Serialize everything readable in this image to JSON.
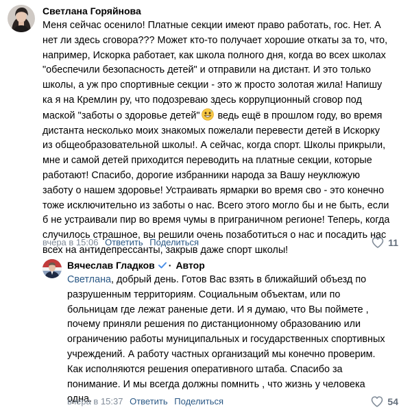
{
  "comment1": {
    "author": "Светлана Горяйнова",
    "lines": [
      "Меня сейчас осенило! Платные секции имеют право работать, гос. Нет. А",
      "нет ли здесь сговора??? Может кто-то получает хорошие откаты за то, что,",
      "например, Искорка работает, как школа полного дня, когда во всех школах",
      "\"обеспечили безопасность детей\" и отправили на дистант. И это только",
      "школы, а уж про спортивные секции - это ж просто золотая жила! Напишу",
      "ка я на Кремлин ру, что подозреваю здесь коррупционный сговор под",
      "маской \"заботы о здоровье детей\"",
      " ведь ещё в прошлом году, во время",
      "дистанта несколько моих знакомых пожелали перевести детей в Искорку",
      "из общеобразовательной школы!. А сейчас, когда спорт. Школы прикрыли,",
      "мне и самой детей приходится переводить на платные секции, которые",
      "работают! Спасибо, дорогие избранники народа за Вашу неуклюжую",
      "заботу о нашем здоровье! Устраивать ярмарки во время сво - это конечно",
      "тоже исключительно из заботы о нас. Всего этого могло бы и не быть, если",
      "б не устраивали пир во время чумы в приграничном регионе! Теперь, когда",
      "случилось страшное, вы решили очень позаботиться о нас и посадить нас",
      "всех на антидепрессанты, закрыв даже спорт школы!"
    ],
    "time": "вчера в 15:06",
    "reply_label": "Ответить",
    "share_label": "Поделиться",
    "likes": "11",
    "emoji": "grinning-face-with-sweat-emoji"
  },
  "comment2": {
    "author": "Вячеслав Гладков",
    "author_badge": "Автор",
    "mention": "Светлана",
    "lines": [
      ", добрый день. Готов Вас взять в ближайший объезд по",
      "разрушенным территориям. Социальным объектам, или по",
      "больницам где лежат раненые дети. И я думаю, что Вы поймете ,",
      "почему приняли решения по дистанционному образованию или",
      "ограничению работы муниципальных и государственных спортивных",
      "учреждений. А работу частных организаций мы конечно проверим.",
      "Как исполняются решения оперативного штаба. Спасибо за",
      "понимание. И мы всегда должны помнить , что жизнь у человека",
      "одна."
    ],
    "time": "вчера в 15:37",
    "reply_label": "Ответить",
    "share_label": "Поделиться",
    "likes": "54"
  },
  "colors": {
    "link": "#2a5885",
    "meta": "#818c99",
    "verified": "#4a8fe7"
  }
}
